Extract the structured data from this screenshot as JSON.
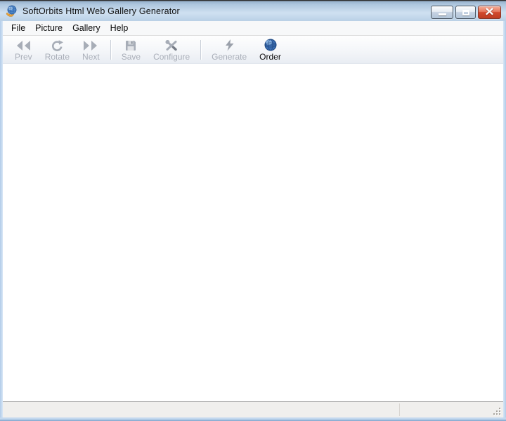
{
  "window": {
    "title": "SoftOrbits Html Web Gallery Generator",
    "app_icon": "globe-gallery-app-icon"
  },
  "window_controls": {
    "minimize_icon": "minimize-icon",
    "maximize_icon": "maximize-icon",
    "close_icon": "close-icon"
  },
  "menu": {
    "items": [
      {
        "label": "File"
      },
      {
        "label": "Picture"
      },
      {
        "label": "Gallery"
      },
      {
        "label": "Help"
      }
    ]
  },
  "toolbar": {
    "buttons": [
      {
        "label": "Prev",
        "icon": "prev-icon",
        "enabled": false
      },
      {
        "label": "Rotate",
        "icon": "rotate-icon",
        "enabled": false
      },
      {
        "label": "Next",
        "icon": "next-icon",
        "enabled": false
      },
      {
        "label": "Save",
        "icon": "save-icon",
        "enabled": false
      },
      {
        "label": "Configure",
        "icon": "configure-icon",
        "enabled": false
      },
      {
        "label": "Generate",
        "icon": "generate-icon",
        "enabled": false
      },
      {
        "label": "Order",
        "icon": "order-globe-icon",
        "enabled": true
      }
    ],
    "separators_after": [
      "Next",
      "Configure"
    ]
  },
  "statusbar": {
    "left_panel_text": "",
    "right_panel_text": ""
  },
  "colors": {
    "titlebar_top": "#93aecb",
    "titlebar_bottom": "#b9d0e6",
    "window_border": "#c3d8ee",
    "close_button_red": "#d14a2e",
    "disabled_text": "#a9aeb8",
    "enabled_text": "#0a0a0a",
    "order_globe_blue": "#3a6cb0",
    "statusbar_bg": "#f0efed"
  }
}
